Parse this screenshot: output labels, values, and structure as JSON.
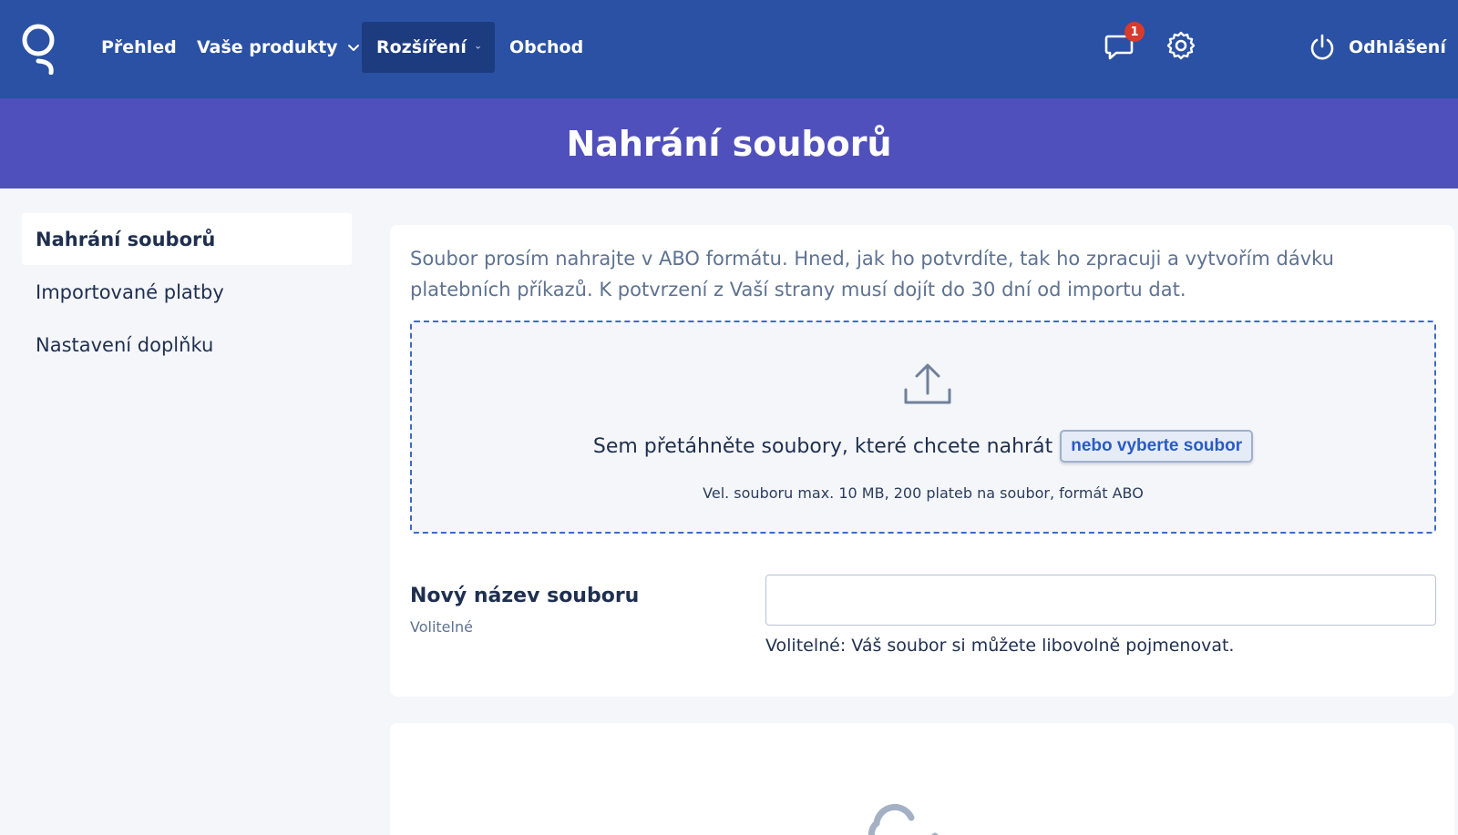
{
  "nav": {
    "items": [
      {
        "label": "Přehled",
        "active": false,
        "dropdown": false
      },
      {
        "label": "Vaše produkty",
        "active": false,
        "dropdown": true
      },
      {
        "label": "Rozšíření",
        "active": true,
        "dropdown": true
      },
      {
        "label": "Obchod",
        "active": false,
        "dropdown": false
      }
    ],
    "messages_badge": "1",
    "logout_label": "Odhlášení",
    "icons": [
      "logo-icon",
      "chevron-down-icon",
      "chat-icon",
      "gear-icon",
      "power-icon"
    ]
  },
  "banner": {
    "title": "Nahrání souborů"
  },
  "sidebar": {
    "items": [
      {
        "label": "Nahrání souborů",
        "active": true
      },
      {
        "label": "Importované platby",
        "active": false
      },
      {
        "label": "Nastavení doplňku",
        "active": false
      }
    ]
  },
  "upload": {
    "intro": "Soubor prosím nahrajte v ABO formátu. Hned, jak ho potvrdíte, tak ho zpracuji a vytvořím dávku platebních příkazů. K potvrzení z Vaší strany musí dojít do 30 dní od importu dat.",
    "drop_text": "Sem přetáhněte soubory, které chcete nahrát",
    "pick_label": "nebo vyberte soubor",
    "hint": "Vel. souboru max. 10 MB, 200 plateb na soubor, formát ABO"
  },
  "rename": {
    "label": "Nový název souboru",
    "sublabel": "Volitelné",
    "value": "",
    "help": "Volitelné: Váš soubor si můžete libovolně pojmenovat."
  },
  "colors": {
    "nav_bg": "#2a51a3",
    "banner_bg": "#5050bc",
    "page_bg": "#f4f6fa",
    "accent": "#2a5bc4",
    "badge": "#d83a2e"
  }
}
